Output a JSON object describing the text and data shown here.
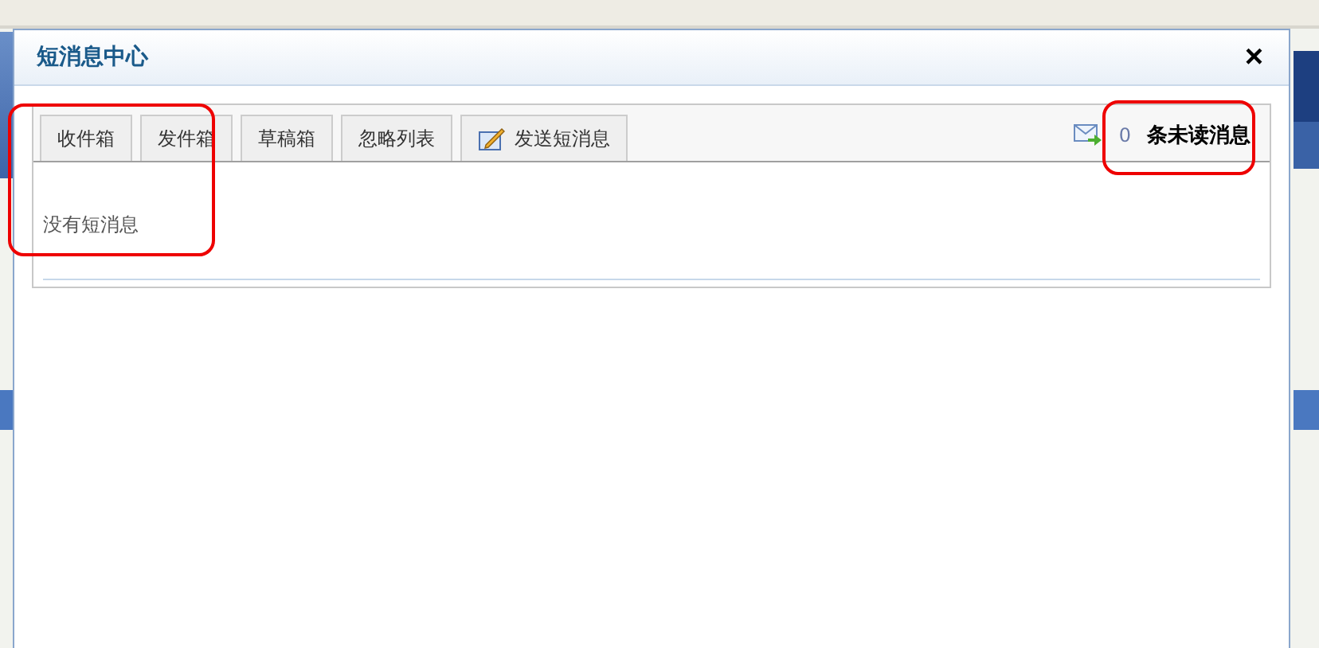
{
  "dialog": {
    "title": "短消息中心",
    "close": "×"
  },
  "tabs": [
    {
      "label": "收件箱",
      "selected": false,
      "kind": "plain"
    },
    {
      "label": "发件箱",
      "selected": false,
      "kind": "plain"
    },
    {
      "label": "草稿箱",
      "selected": false,
      "kind": "plain"
    },
    {
      "label": "忽略列表",
      "selected": false,
      "kind": "plain"
    },
    {
      "label": "发送短消息",
      "selected": false,
      "kind": "compose"
    }
  ],
  "unread": {
    "count": "0",
    "label": "条未读消息"
  },
  "message": "没有短消息"
}
